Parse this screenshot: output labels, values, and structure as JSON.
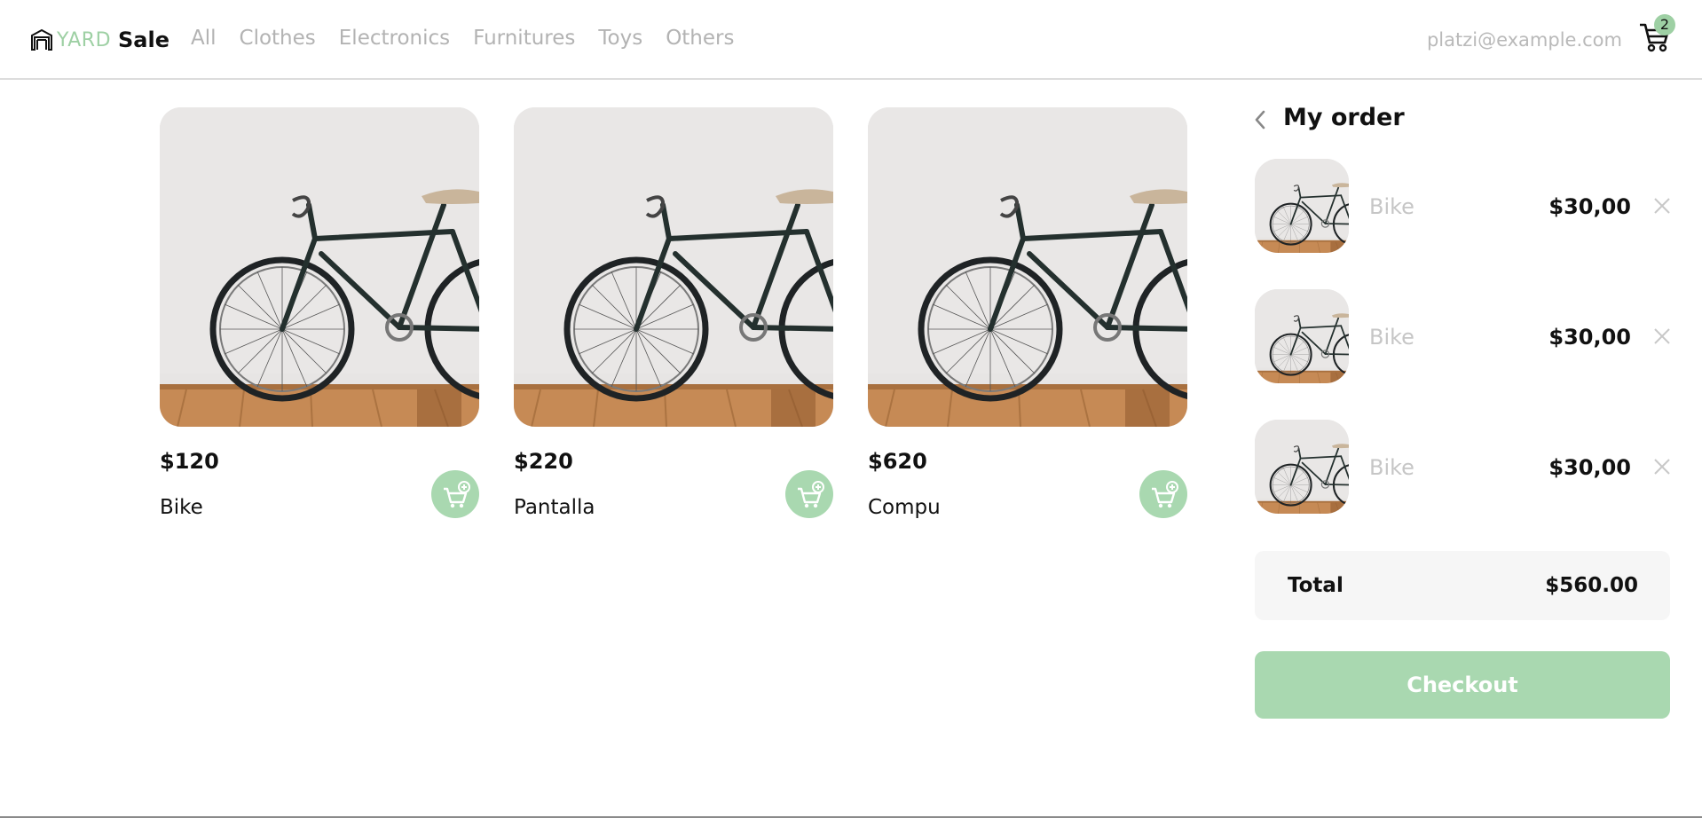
{
  "brand": {
    "yard": "YARD",
    "sale": "Sale",
    "accent": "#9ed0a4"
  },
  "nav": {
    "links": [
      "All",
      "Clothes",
      "Electronics",
      "Furnitures",
      "Toys",
      "Others"
    ],
    "email": "platzi@example.com",
    "cart_count": "2",
    "cart_icon": "shopping-cart-icon"
  },
  "products": [
    {
      "price": "$120",
      "name": "Bike"
    },
    {
      "price": "$220",
      "name": "Pantalla"
    },
    {
      "price": "$620",
      "name": "Compu"
    }
  ],
  "order": {
    "title": "My order",
    "items": [
      {
        "name": "Bike",
        "price": "$30,00"
      },
      {
        "name": "Bike",
        "price": "$30,00"
      },
      {
        "name": "Bike",
        "price": "$30,00"
      }
    ],
    "total_label": "Total",
    "total_value": "$560.00",
    "checkout_label": "Checkout"
  }
}
